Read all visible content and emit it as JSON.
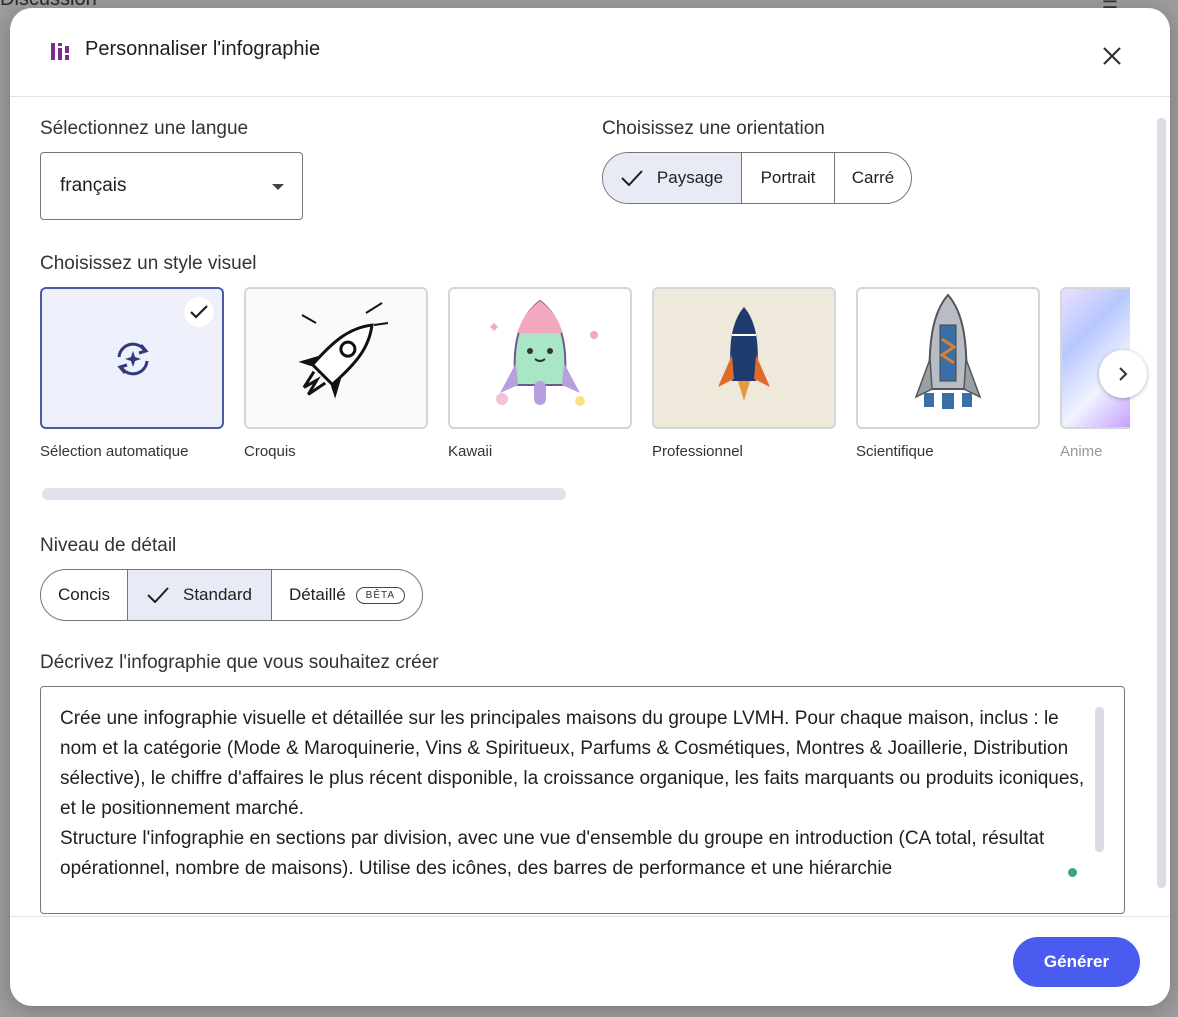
{
  "backdrop": {
    "title": "Discussion"
  },
  "dialog": {
    "title": "Personnaliser l'infographie",
    "language": {
      "label": "Sélectionnez une langue",
      "value": "français"
    },
    "orientation": {
      "label": "Choisissez une orientation",
      "options": [
        "Paysage",
        "Portrait",
        "Carré"
      ],
      "selected": "Paysage"
    },
    "visual_style": {
      "label": "Choisissez un style visuel",
      "options": [
        "Sélection automatique",
        "Croquis",
        "Kawaii",
        "Professionnel",
        "Scientifique",
        "Anime"
      ],
      "selected": "Sélection automatique"
    },
    "detail": {
      "label": "Niveau de détail",
      "options": [
        "Concis",
        "Standard",
        "Détaillé"
      ],
      "selected": "Standard",
      "beta_badge": "BÊTA"
    },
    "description": {
      "label": "Décrivez l'infographie que vous souhaitez créer",
      "value": "Crée une infographie visuelle et détaillée sur les principales maisons du groupe LVMH. Pour chaque maison, inclus : le nom et la catégorie (Mode & Maroquinerie, Vins & Spiritueux, Parfums & Cosmétiques, Montres & Joaillerie, Distribution sélective), le chiffre d'affaires le plus récent disponible, la croissance organique, les faits marquants ou produits iconiques, et le positionnement marché.\nStructure l'infographie en sections par division, avec une vue d'ensemble du groupe en introduction (CA total, résultat opérationnel, nombre de maisons). Utilise des icônes, des barres de performance et une hiérarchie"
    },
    "generate_label": "Générer"
  },
  "colors": {
    "accent": "#4a5cf0",
    "selected_bg": "#e8eaf6",
    "header_icon": "#7b2d8e"
  }
}
